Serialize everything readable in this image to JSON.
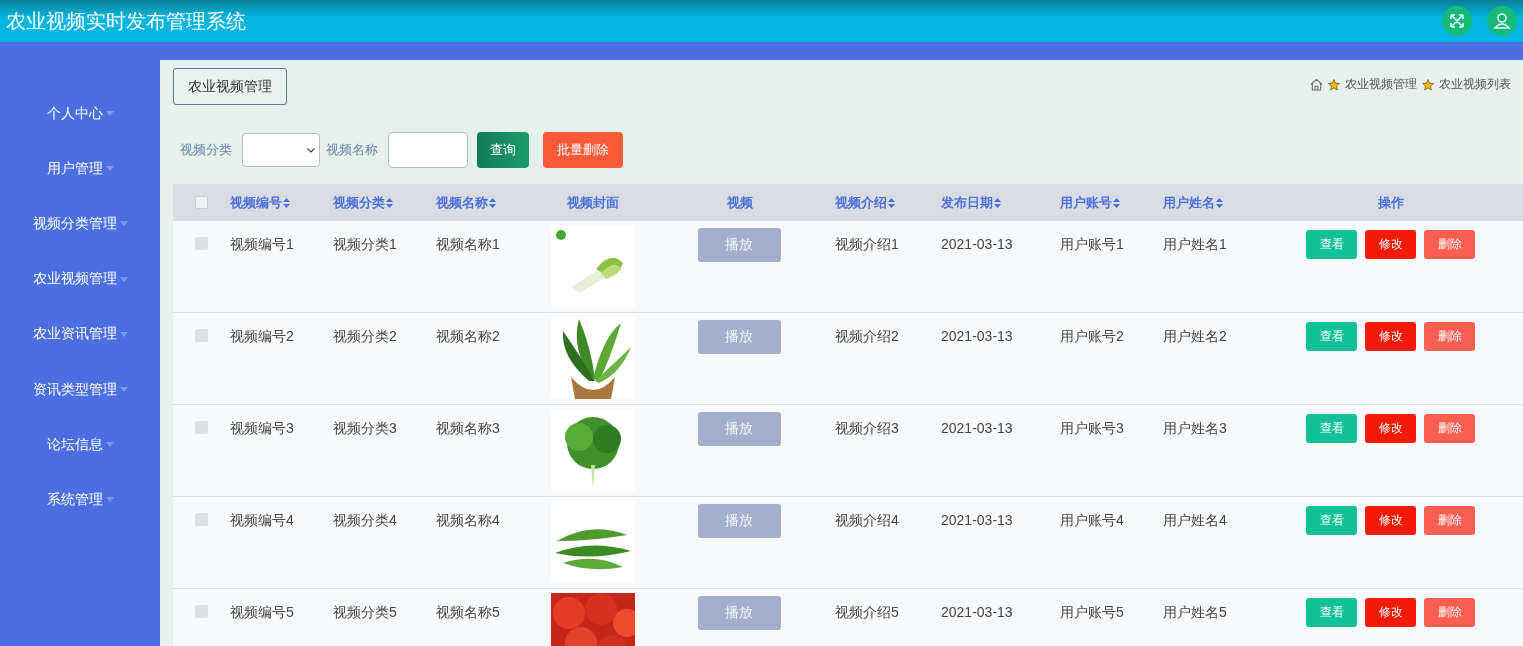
{
  "header": {
    "title": "农业视频实时发布管理系统"
  },
  "sidebar": {
    "items": [
      {
        "label": "个人中心",
        "expanded": false
      },
      {
        "label": "用户管理",
        "expanded": false
      },
      {
        "label": "视频分类管理",
        "expanded": false
      },
      {
        "label": "农业视频管理",
        "expanded": false
      },
      {
        "label": "农业资讯管理",
        "expanded": false
      },
      {
        "label": "资讯类型管理",
        "expanded": false
      },
      {
        "label": "论坛信息",
        "expanded": false
      },
      {
        "label": "系统管理",
        "expanded": false
      }
    ]
  },
  "page_tab": "农业视频管理",
  "breadcrumb": [
    "农业视频管理",
    "农业视频列表"
  ],
  "filters": {
    "category_label": "视频分类",
    "name_label": "视频名称",
    "query_button": "查询",
    "batch_delete_button": "批量删除"
  },
  "table": {
    "select_all_checked": false,
    "columns": [
      {
        "label": "视频编号",
        "sortable": true
      },
      {
        "label": "视频分类",
        "sortable": true
      },
      {
        "label": "视频名称",
        "sortable": true
      },
      {
        "label": "视频封面",
        "sortable": false
      },
      {
        "label": "视频",
        "sortable": false
      },
      {
        "label": "视频介绍",
        "sortable": true
      },
      {
        "label": "发布日期",
        "sortable": true
      },
      {
        "label": "用户账号",
        "sortable": true
      },
      {
        "label": "用户姓名",
        "sortable": true
      },
      {
        "label": "操作",
        "sortable": false
      }
    ],
    "rows": [
      {
        "checked": false,
        "id": "视频编号1",
        "category": "视频分类1",
        "name": "视频名称1",
        "play": "播放",
        "intro": "视频介绍1",
        "date": "2021-03-13",
        "account": "用户账号1",
        "user": "用户姓名1",
        "actions": [
          "查看",
          "修改",
          "删除"
        ]
      },
      {
        "checked": false,
        "id": "视频编号2",
        "category": "视频分类2",
        "name": "视频名称2",
        "play": "播放",
        "intro": "视频介绍2",
        "date": "2021-03-13",
        "account": "用户账号2",
        "user": "用户姓名2",
        "actions": [
          "查看",
          "修改",
          "删除"
        ]
      },
      {
        "checked": false,
        "id": "视频编号3",
        "category": "视频分类3",
        "name": "视频名称3",
        "play": "播放",
        "intro": "视频介绍3",
        "date": "2021-03-13",
        "account": "用户账号3",
        "user": "用户姓名3",
        "actions": [
          "查看",
          "修改",
          "删除"
        ]
      },
      {
        "checked": false,
        "id": "视频编号4",
        "category": "视频分类4",
        "name": "视频名称4",
        "play": "播放",
        "intro": "视频介绍4",
        "date": "2021-03-13",
        "account": "用户账号4",
        "user": "用户姓名4",
        "actions": [
          "查看",
          "修改",
          "删除"
        ]
      },
      {
        "checked": false,
        "id": "视频编号5",
        "category": "视频分类5",
        "name": "视频名称5",
        "play": "播放",
        "intro": "视频介绍5",
        "date": "2021-03-13",
        "account": "用户账号5",
        "user": "用户姓名5",
        "actions": [
          "查看",
          "修改",
          "删除"
        ]
      }
    ]
  }
}
